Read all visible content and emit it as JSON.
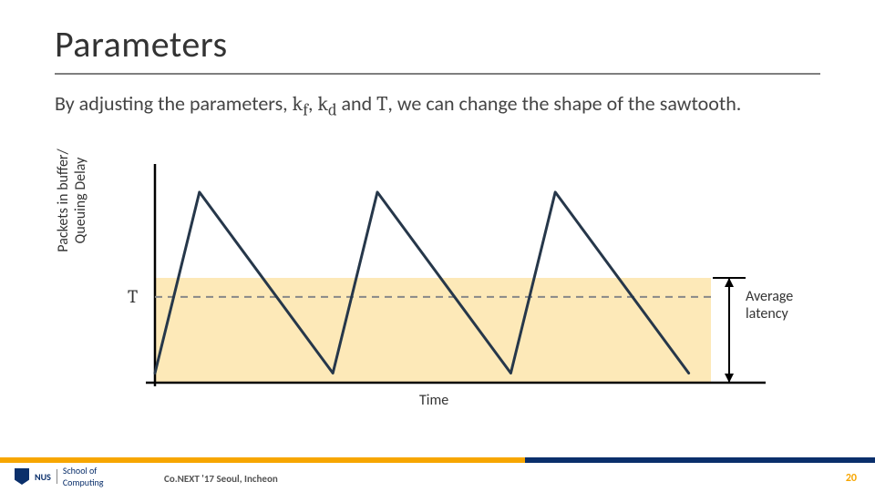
{
  "title": "Parameters",
  "body_text_pre": "By adjusting the parameters, ",
  "sym_kf": "k",
  "sym_kf_sub": "f",
  "sym_sep1": ", ",
  "sym_kd": "k",
  "sym_kd_sub": "d",
  "sym_and": " and ",
  "sym_T": "T",
  "body_text_post": ", we can change the shape of the sawtooth.",
  "ylabel_line1": "Packets in buffer/",
  "ylabel_line2": "Queuing Delay",
  "T_label": "T",
  "xlabel": "Time",
  "avg_label_line1": "Average",
  "avg_label_line2": "latency",
  "footer_org1": "NUS",
  "footer_org2": "School of",
  "footer_org3": "Computing",
  "footer_venue": "Co.NEXT '17 Seoul, Incheon",
  "footer_page": "20",
  "chart_data": {
    "type": "line",
    "title": "",
    "xlabel": "Time",
    "ylabel": "Packets in buffer/ Queuing Delay",
    "series": [
      {
        "name": "sawtooth",
        "x": [
          0,
          10,
          40,
          50,
          80,
          90,
          120
        ],
        "y": [
          5,
          100,
          5,
          100,
          5,
          100,
          5
        ]
      }
    ],
    "threshold_T": 45,
    "shaded_band_y": [
      0,
      55
    ],
    "avg_latency_marker_y": [
      0,
      55
    ],
    "xlim": [
      0,
      125
    ],
    "ylim": [
      0,
      110
    ]
  }
}
